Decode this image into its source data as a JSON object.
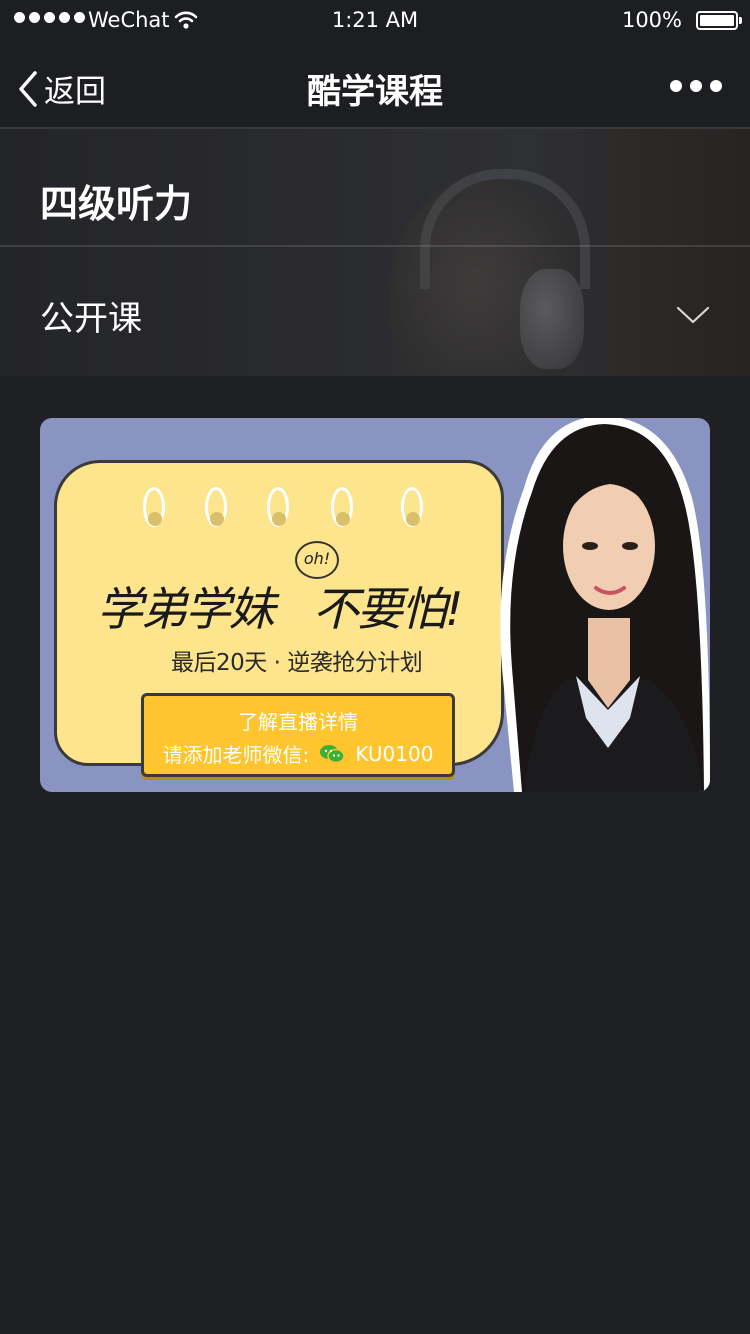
{
  "status_bar": {
    "carrier": "WeChat",
    "time": "1:21 AM",
    "battery": "100%"
  },
  "nav": {
    "back_label": "返回",
    "title": "酷学课程"
  },
  "header": {
    "title": "四级听力",
    "subtitle": "公开课"
  },
  "banner": {
    "oh": "oh!",
    "headline_part1": "学弟学妹",
    "headline_part2": "不要怕!",
    "subline": "最后20天 · 逆袭抢分计划",
    "cta_line1": "了解直播详情",
    "cta_line2": "请添加老师微信:",
    "wechat_id": "KU0100",
    "background_color": "#8a94c2",
    "note_color": "#fde58e",
    "cta_color": "#fec52e"
  },
  "icons": [
    "signal-dots-icon",
    "wifi-icon",
    "battery-icon",
    "back-chevron-icon",
    "more-dots-icon",
    "chevron-down-icon",
    "wechat-icon"
  ]
}
